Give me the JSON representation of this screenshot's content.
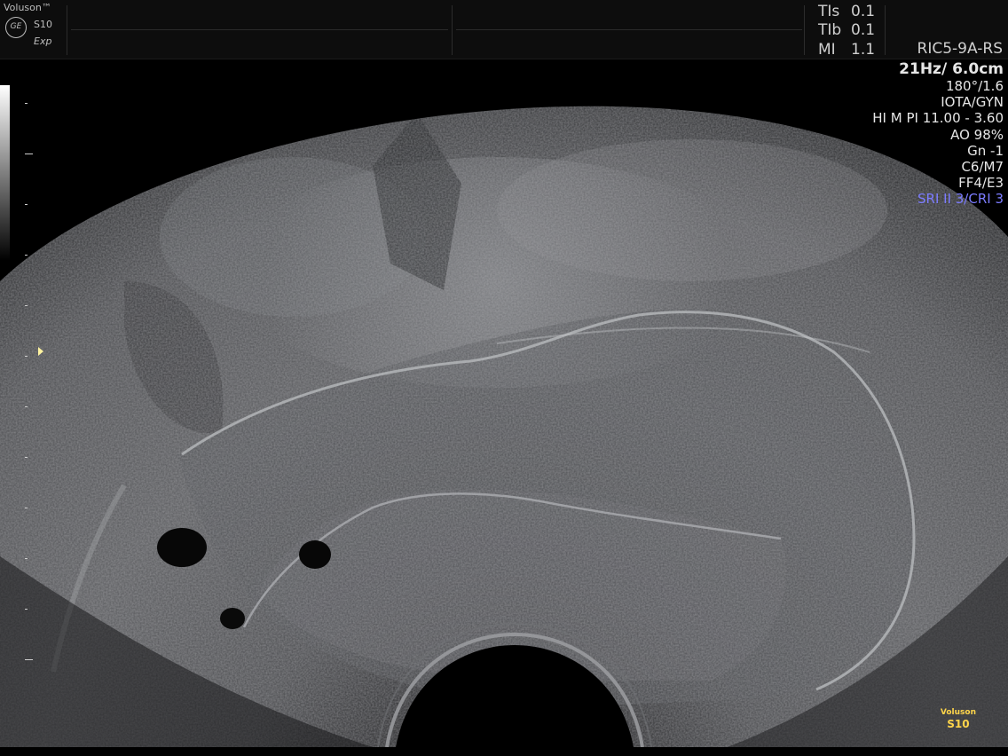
{
  "header": {
    "brand": "Voluson™",
    "logo_text": "GE",
    "model": "S10",
    "edition": "Exp",
    "indices": [
      {
        "label": "TIs",
        "value": "0.1"
      },
      {
        "label": "TIb",
        "value": "0.1"
      },
      {
        "label": "MI",
        "value": "1.1"
      }
    ],
    "probe": "RIC5-9A-RS"
  },
  "parameters": {
    "frame_depth": "21Hz/ 6.0cm",
    "angle": "180°/1.6",
    "preset": "IOTA/GYN",
    "harmonics": "HI M PI 11.00 - 3.60",
    "ao": "AO 98%",
    "gain": "Gn  -1",
    "map": "C6/M7",
    "filter": "FF4/E3",
    "sri": "SRI II 3/CRI 3"
  },
  "watermark": {
    "line1": "Voluson",
    "line2": "S10"
  },
  "colors": {
    "sri_text": "#7c7cff",
    "watermark": "#ffd54a",
    "focus_marker": "#fff3a0"
  }
}
